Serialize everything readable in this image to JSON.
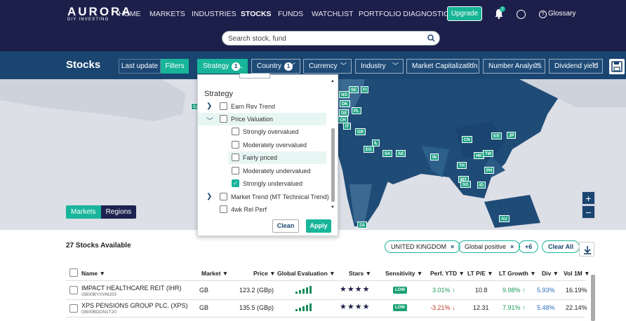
{
  "brand": {
    "name": "AURORA",
    "tagline": "DIY INVESTING"
  },
  "nav": {
    "home": "HOME",
    "markets": "MARKETS",
    "industries": "INDUSTRIES",
    "stocks": "STOCKS",
    "funds": "FUNDS",
    "watchlist": "WATCHLIST",
    "portfolio": "PORTFOLIO DIAGNOSTIC",
    "upgrade": "Upgrade",
    "notif_count": "2",
    "glossary": "Glossary"
  },
  "search": {
    "placeholder": "Search stock, fund"
  },
  "toolbar": {
    "title": "Stocks",
    "last_update": "Last update",
    "filters": "Filters",
    "strategy": "Strategy",
    "strategy_count": "1",
    "country": "Country",
    "country_count": "1",
    "currency": "Currency",
    "industry": "Industry",
    "market_cap": "Market Capitalization",
    "number_analysts": "Number Analysts",
    "dividend_yield": "Dividend yield"
  },
  "map": {
    "labels": [
      "CA",
      "SE",
      "FI",
      "NO",
      "DK",
      "DE",
      "PL",
      "CH",
      "IT",
      "GR",
      "IL",
      "EG",
      "SA",
      "AE",
      "IN",
      "CN",
      "KR",
      "JP",
      "HK",
      "TW",
      "TH",
      "PH",
      "MY",
      "SG",
      "ID",
      "AU",
      "ZA"
    ],
    "toggle": {
      "markets": "Markets",
      "regions": "Regions"
    },
    "zoom_in": "+",
    "zoom_out": "−"
  },
  "strategy_panel": {
    "title": "Strategy",
    "items": [
      {
        "label": "Earn Rev Trend"
      },
      {
        "label": "Price Valuation"
      },
      {
        "label": "Strongly overvalued"
      },
      {
        "label": "Moderately overvalued"
      },
      {
        "label": "Fairly priced"
      },
      {
        "label": "Moderately undervalued"
      },
      {
        "label": "Strongly undervalued"
      },
      {
        "label": "Market Trend (MT Technical Trend)"
      },
      {
        "label": "4wk Rel Perf"
      }
    ],
    "clean": "Clean",
    "apply": "Apply"
  },
  "results": {
    "count": "27 Stocks Available",
    "chips": [
      "UNITED KINGDOM",
      "Global positive"
    ],
    "more": "+6",
    "clear_all": "Clear All"
  },
  "table": {
    "headers": [
      "Name",
      "Market",
      "Price",
      "Global Evaluation",
      "Stars",
      "Sensitivity",
      "Perf. YTD",
      "LT P/E",
      "LT Growth",
      "Div",
      "Vol 1M"
    ],
    "rows": [
      {
        "name": "IMPACT HEALTHCARE REIT (IHR)",
        "isin": "GB00BYXVMJ03",
        "market": "GB",
        "price": "123.2 (GBp)",
        "stars": "★★★★",
        "sensitivity": "LOW",
        "perf": "3.01%",
        "pe": "10.8",
        "growth": "9.98%",
        "div": "5.93%",
        "vol": "16.19%"
      },
      {
        "name": "XPS PENSIONS GROUP PLC. (XPS)",
        "isin": "GB00BDDN1T20",
        "market": "GB",
        "price": "135.5 (GBp)",
        "stars": "★★★★",
        "sensitivity": "LOW",
        "perf": "-3.21%",
        "pe": "12.31",
        "growth": "7.91%",
        "div": "5.48%",
        "vol": "22.14%"
      }
    ]
  },
  "colors": {
    "navy": "#1c1f4a",
    "teal": "#18b59a",
    "toolbar": "#1a4570",
    "positive": "#1a9a5a",
    "negative": "#c0392b",
    "link_blue": "#2a6fb8"
  }
}
